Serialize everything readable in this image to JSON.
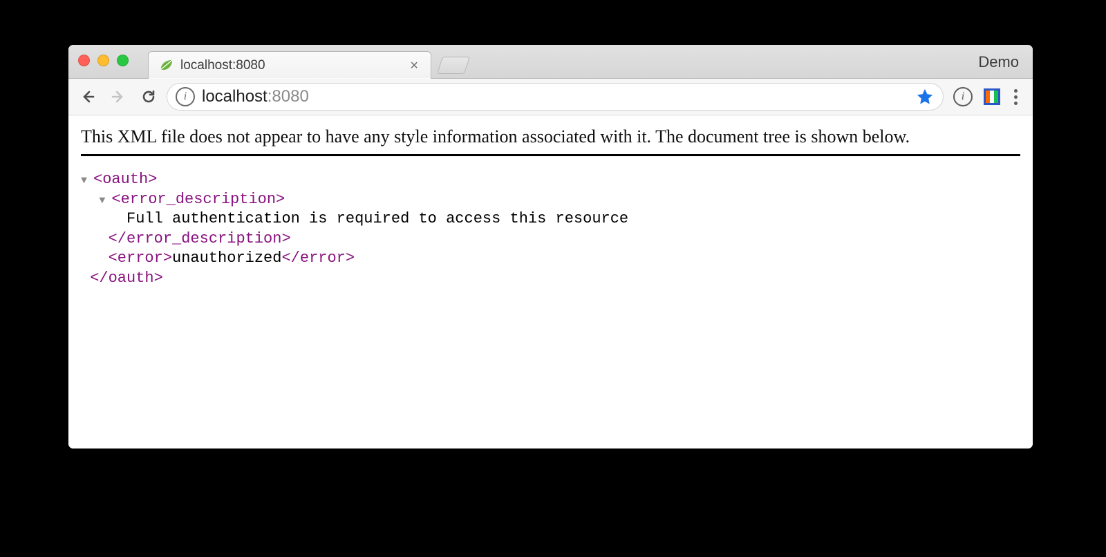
{
  "window": {
    "right_label": "Demo"
  },
  "tab": {
    "title": "localhost:8080"
  },
  "address": {
    "host": "localhost",
    "port": ":8080"
  },
  "content": {
    "banner": "This XML file does not appear to have any style information associated with it. The document tree is shown below.",
    "xml": {
      "root_open": "<oauth>",
      "root_close": "</oauth>",
      "err_desc_open": "<error_description>",
      "err_desc_text": "Full authentication is required to access this resource",
      "err_desc_close": "</error_description>",
      "error_open": "<error>",
      "error_text": "unauthorized",
      "error_close": "</error>"
    }
  }
}
